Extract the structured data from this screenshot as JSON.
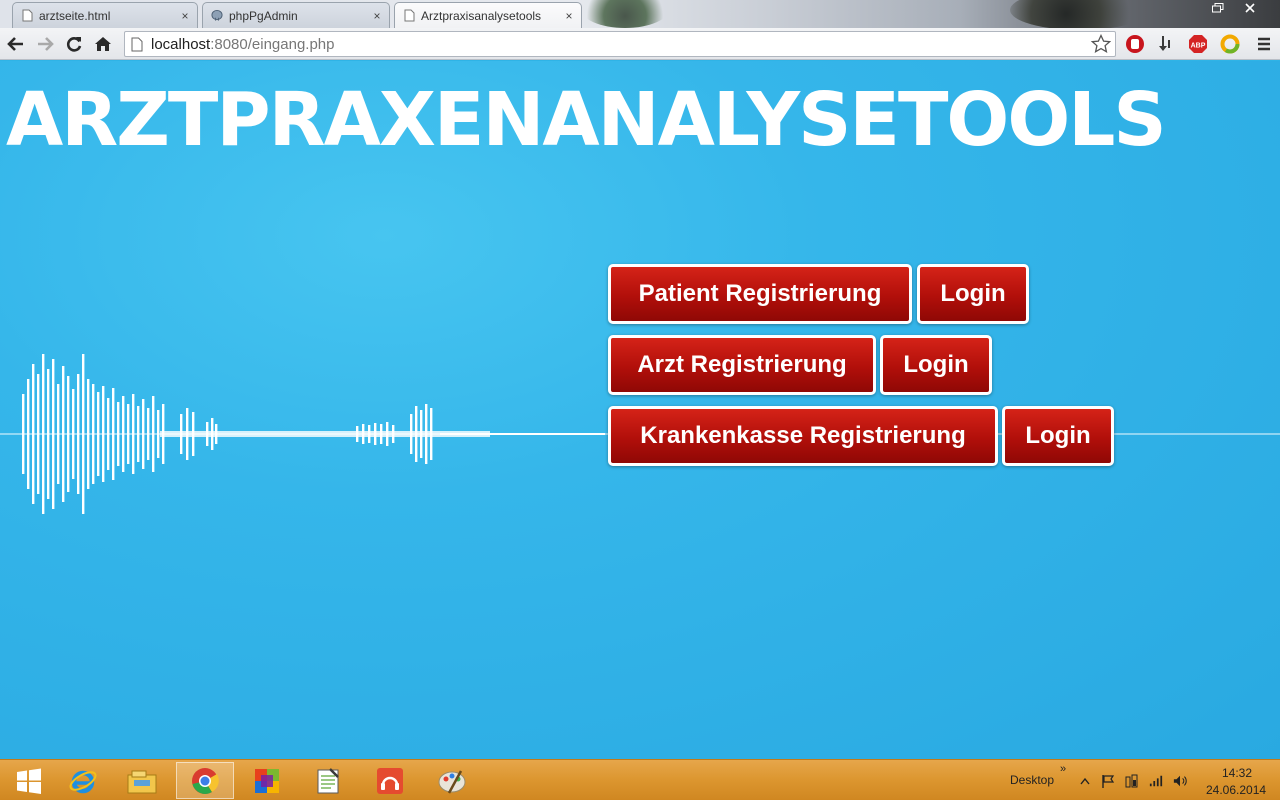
{
  "browser": {
    "tabs": [
      {
        "title": "arztseite.html",
        "icon": "page-icon",
        "close": "×"
      },
      {
        "title": "phpPgAdmin",
        "icon": "elephant-icon",
        "close": "×"
      },
      {
        "title": "Arztpraxisanalysetools",
        "icon": "page-icon",
        "close": "×",
        "active": true
      }
    ],
    "url_host": "localhost",
    "url_rest": ":8080/eingang.php"
  },
  "page": {
    "title": "ARZTPRAXENANALYSETOOLS",
    "rows": [
      {
        "register": "Patient Registrierung",
        "login": "Login"
      },
      {
        "register": "Arzt Registrierung",
        "login": "Login"
      },
      {
        "register": "Krankenkasse Registrierung",
        "login": "Login"
      }
    ]
  },
  "taskbar": {
    "pinned": [
      "windows-start-icon",
      "internet-explorer-icon",
      "file-explorer-icon",
      "chrome-icon",
      "office-icon",
      "notepad-icon",
      "media-player-icon",
      "paint-icon"
    ],
    "desktop_label": "Desktop",
    "chevron": "»",
    "time": "14:32",
    "date": "24.06.2014"
  },
  "colors": {
    "page_bg": "#2fb3e6",
    "button_red": "#b10f0a",
    "taskbar": "#dc962f"
  }
}
